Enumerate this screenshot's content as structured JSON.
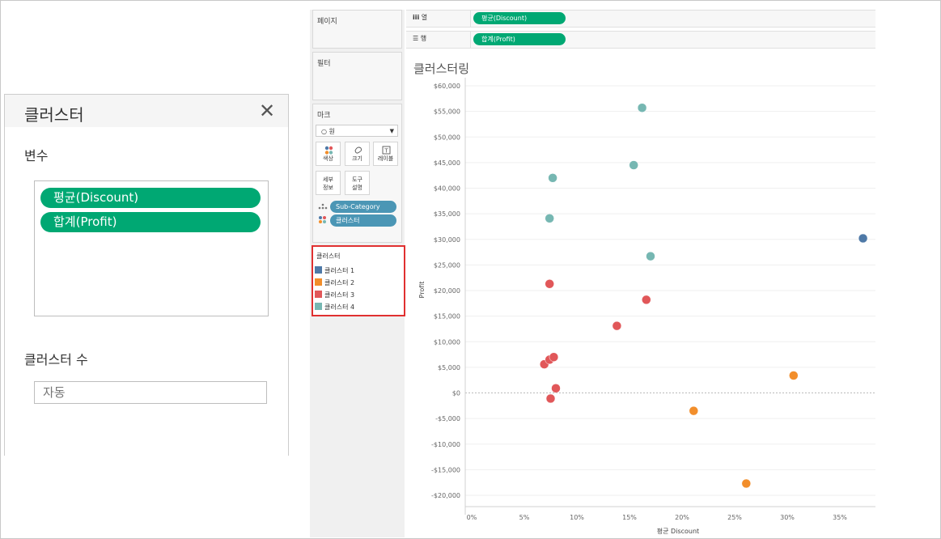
{
  "dialog": {
    "title": "클러스터",
    "variables_label": "변수",
    "variables": [
      "평균(Discount)",
      "합계(Profit)"
    ],
    "cluster_count_label": "클러스터 수",
    "cluster_count_placeholder": "자동"
  },
  "panels": {
    "pages": "페이지",
    "filters": "필터",
    "marks": "마크",
    "mark_type": "○ 원",
    "buttons": {
      "color": "색상",
      "size": "크기",
      "label": "레이블",
      "detail": "세부\n정보",
      "tooltip": "도구\n설명"
    },
    "mark_fields": [
      "Sub-Category",
      "클러스터"
    ]
  },
  "legend": {
    "title": "클러스터",
    "items": [
      {
        "label": "클러스터 1",
        "color": "#4e79a7"
      },
      {
        "label": "클러스터 2",
        "color": "#f28e2b"
      },
      {
        "label": "클러스터 3",
        "color": "#e15759"
      },
      {
        "label": "클러스터 4",
        "color": "#76b7b2"
      }
    ]
  },
  "shelves": {
    "columns_label": "열",
    "rows_label": "행",
    "columns_pill": "평균(Discount)",
    "rows_pill": "합계(Profit)"
  },
  "sheet": {
    "title": "클러스터링"
  },
  "chart_data": {
    "type": "scatter",
    "title": "클러스터링",
    "xlabel": "평균 Discount",
    "ylabel": "Profit",
    "xlim": [
      -0.02,
      0.38
    ],
    "ylim": [
      -22000,
      61000
    ],
    "x_ticks": [
      0,
      0.05,
      0.1,
      0.15,
      0.2,
      0.25,
      0.3,
      0.35
    ],
    "x_tick_labels": [
      "0%",
      "5%",
      "10%",
      "15%",
      "20%",
      "25%",
      "30%",
      "35%"
    ],
    "y_ticks": [
      -20000,
      -15000,
      -10000,
      -5000,
      0,
      5000,
      10000,
      15000,
      20000,
      25000,
      30000,
      35000,
      40000,
      45000,
      50000,
      55000,
      60000
    ],
    "y_tick_labels": [
      "-$20,000",
      "-$15,000",
      "-$10,000",
      "-$5,000",
      "$0",
      "$5,000",
      "$10,000",
      "$15,000",
      "$20,000",
      "$25,000",
      "$30,000",
      "$35,000",
      "$40,000",
      "$45,000",
      "$50,000",
      "$55,000",
      "$60,000"
    ],
    "grid": "horizontal",
    "series": [
      {
        "name": "클러스터 1",
        "color": "#4e79a7",
        "points": [
          [
            0.372,
            30200
          ]
        ]
      },
      {
        "name": "클러스터 2",
        "color": "#f28e2b",
        "points": [
          [
            0.306,
            3400
          ],
          [
            0.211,
            -3500
          ],
          [
            0.261,
            -17700
          ]
        ]
      },
      {
        "name": "클러스터 3",
        "color": "#e15759",
        "points": [
          [
            0.074,
            21300
          ],
          [
            0.166,
            18200
          ],
          [
            0.138,
            13100
          ],
          [
            0.069,
            5600
          ],
          [
            0.074,
            6500
          ],
          [
            0.078,
            7000
          ],
          [
            0.08,
            900
          ],
          [
            0.075,
            -1100
          ]
        ]
      },
      {
        "name": "클러스터 4",
        "color": "#76b7b2",
        "points": [
          [
            0.162,
            55700
          ],
          [
            0.154,
            44500
          ],
          [
            0.077,
            42000
          ],
          [
            0.074,
            34100
          ],
          [
            0.17,
            26700
          ]
        ]
      }
    ]
  }
}
